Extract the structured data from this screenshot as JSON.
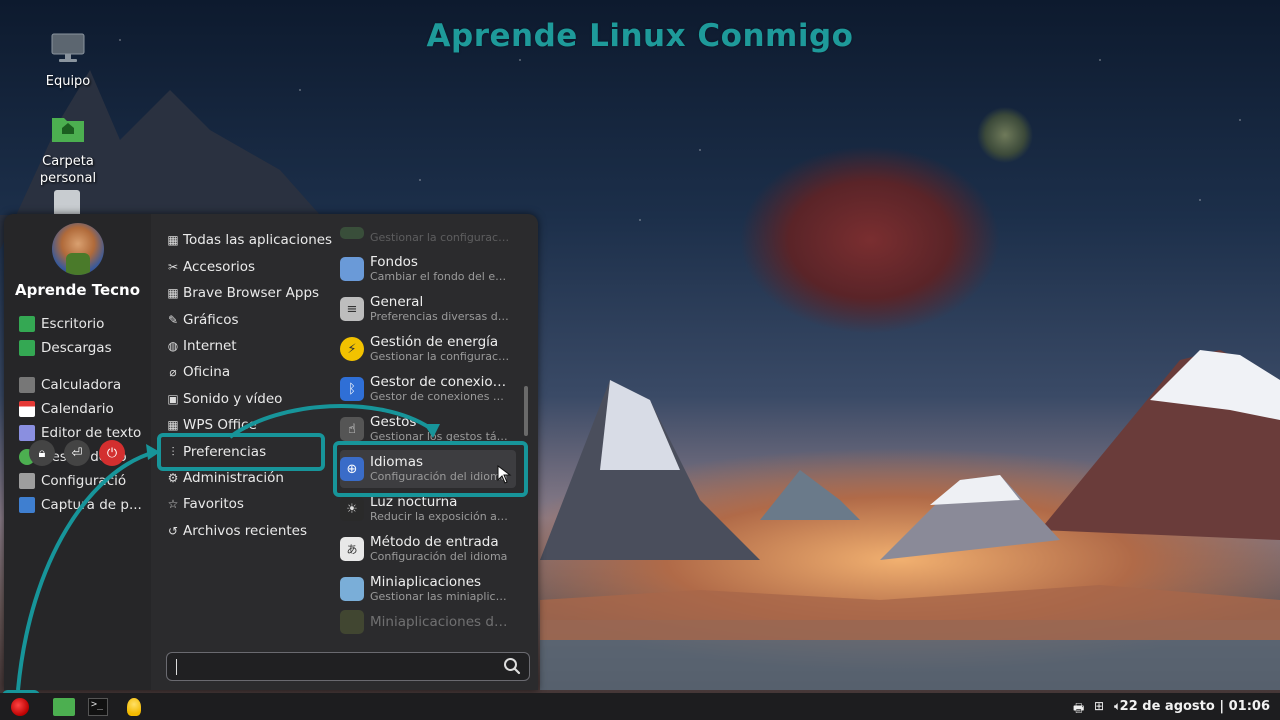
{
  "watermark": "Aprende Linux Conmigo",
  "desktop": {
    "icons": [
      {
        "label": "Equipo"
      },
      {
        "label": "Carpeta\npersonal"
      }
    ]
  },
  "menu": {
    "user_name": "Aprende Tecno",
    "places": [
      {
        "label": "Escritorio",
        "color": "#34a853"
      },
      {
        "label": "Descargas",
        "color": "#34a853"
      }
    ],
    "favorites": [
      {
        "label": "Calculadora",
        "color": "#777777"
      },
      {
        "label": "Calendario",
        "color": "#e53935"
      },
      {
        "label": "Editor de texto",
        "color": "#8a8fe0"
      },
      {
        "label": "Gestor de so",
        "color": "#4caf50"
      },
      {
        "label": "Configuració",
        "color": "#9e9e9e"
      },
      {
        "label": "Captura de p...",
        "color": "#3f7fd0"
      }
    ],
    "categories": [
      {
        "label": "Todas las aplicaciones",
        "icon": "grid-icon"
      },
      {
        "label": "Accesorios",
        "icon": "tools-icon"
      },
      {
        "label": "Brave Browser Apps",
        "icon": "grid-icon"
      },
      {
        "label": "Gráficos",
        "icon": "palette-icon"
      },
      {
        "label": "Internet",
        "icon": "globe-icon"
      },
      {
        "label": "Oficina",
        "icon": "paperclip-icon"
      },
      {
        "label": "Sonido y vídeo",
        "icon": "media-icon"
      },
      {
        "label": "WPS Office",
        "icon": "grid-icon"
      },
      {
        "label": "Preferencias",
        "icon": "sliders-icon"
      },
      {
        "label": "Administración",
        "icon": "gear-icon"
      },
      {
        "label": "Favoritos",
        "icon": "star-icon"
      },
      {
        "label": "Archivos recientes",
        "icon": "history-icon"
      }
    ],
    "apps": [
      {
        "name": "",
        "desc": "Gestionar la configuració...",
        "color": "#4a7a4a",
        "glyph": ""
      },
      {
        "name": "Fondos",
        "desc": "Cambiar el fondo del escri...",
        "color": "#6a9ad8",
        "glyph": ""
      },
      {
        "name": "General",
        "desc": "Preferencias diversas de ...",
        "color": "#bdbdbd",
        "glyph": "≡"
      },
      {
        "name": "Gestión de energía",
        "desc": "Gestionar la configuració...",
        "color": "#f2c200",
        "glyph": "⚡"
      },
      {
        "name": "Gestor de conexion...",
        "desc": "Gestor de conexiones Blu...",
        "color": "#2f6fd6",
        "glyph": "ᛒ"
      },
      {
        "name": "Gestos",
        "desc": "Gestionar los gestos tácti...",
        "color": "#555555",
        "glyph": "☝"
      },
      {
        "name": "Idiomas",
        "desc": "Configuración del idioma",
        "color": "#3a6cc8",
        "glyph": "⊕"
      },
      {
        "name": "Luz nocturna",
        "desc": "Reducir la exposición a la ...",
        "color": "#2a2a2a",
        "glyph": "☀"
      },
      {
        "name": "Método de entrada",
        "desc": "Configuración del idioma",
        "color": "#e8e8e8",
        "glyph": "あ"
      },
      {
        "name": "Miniaplicaciones",
        "desc": "Gestionar las miniaplicaci...",
        "color": "#7aaed8",
        "glyph": ""
      },
      {
        "name": "Miniaplicaciones del...",
        "desc": "",
        "color": "#6a7a3a",
        "glyph": ""
      }
    ],
    "search_placeholder": ""
  },
  "taskbar": {
    "clock": "22 de agosto | 01:06"
  },
  "colors": {
    "highlight": "#17959a",
    "menu_bg": "#2b2b2d"
  }
}
